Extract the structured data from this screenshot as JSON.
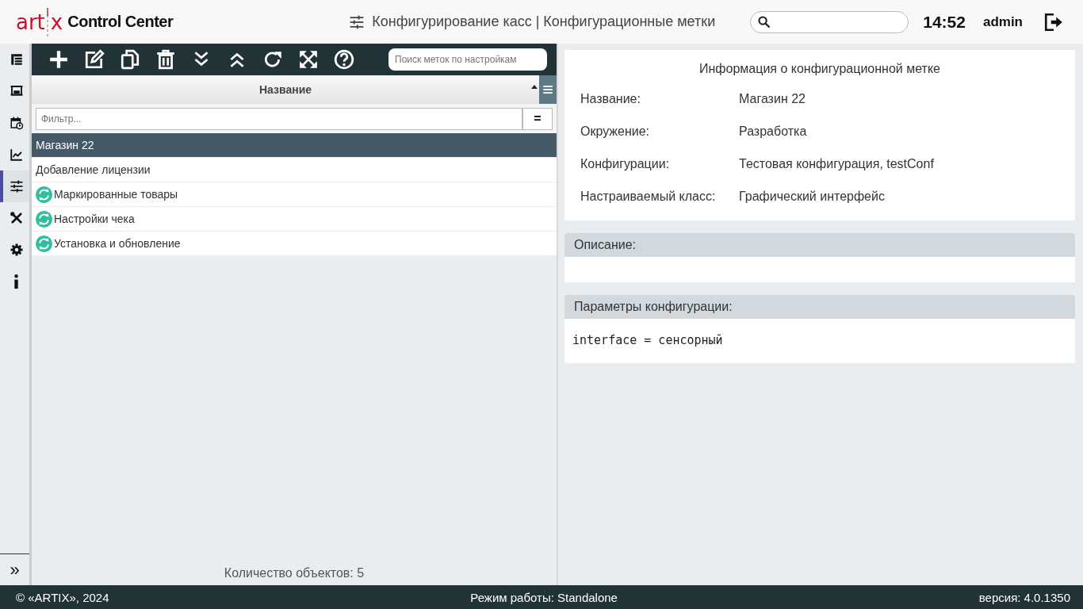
{
  "header": {
    "logo_parts": [
      "art",
      "x"
    ],
    "app_name": "Control Center",
    "page_title": "Конфигурирование касс | Конфигурационные метки",
    "time": "14:52",
    "user": "admin"
  },
  "sidebar": {
    "items": [
      {
        "selected": false
      },
      {
        "selected": false
      },
      {
        "selected": false
      },
      {
        "selected": false
      },
      {
        "selected": true
      },
      {
        "selected": false
      },
      {
        "selected": false
      },
      {
        "selected": false
      }
    ],
    "expand": "»"
  },
  "toolbar": {
    "search": {
      "placeholder": "Поиск меток по настройкам"
    }
  },
  "table": {
    "column": "Название",
    "filter": {
      "placeholder": "Фильтр..."
    },
    "filter_button": "=",
    "rows": [
      {
        "name": "Магазин 22",
        "kind": "plain",
        "selected": true
      },
      {
        "name": "Добавление лицензии",
        "kind": "plain",
        "selected": false
      },
      {
        "name": "Маркированные товары",
        "kind": "synced",
        "selected": false
      },
      {
        "name": "Настройки чека",
        "kind": "synced",
        "selected": false
      },
      {
        "name": "Установка и обновление",
        "kind": "synced",
        "selected": false
      }
    ],
    "count": "Количество объектов: 5"
  },
  "info": {
    "title": "Информация о конфигурационной метке",
    "fields": [
      {
        "label": "Название:",
        "value": "Магазин 22"
      },
      {
        "label": "Окружение:",
        "value": "Разработка"
      },
      {
        "label": "Конфигурации:",
        "value": "Тестовая конфигурация, testConf"
      },
      {
        "label": "Настраиваемый класс:",
        "value": "Графический интерфейс"
      }
    ]
  },
  "description": {
    "title": "Описание:"
  },
  "params": {
    "title": "Параметры конфигурации:",
    "text": "interface = сенсорный"
  },
  "status_bar": {
    "copyright": "© «ARTIX», 2024",
    "mode": "Режим работы: Standalone",
    "version": "версия: 4.0.1350"
  }
}
